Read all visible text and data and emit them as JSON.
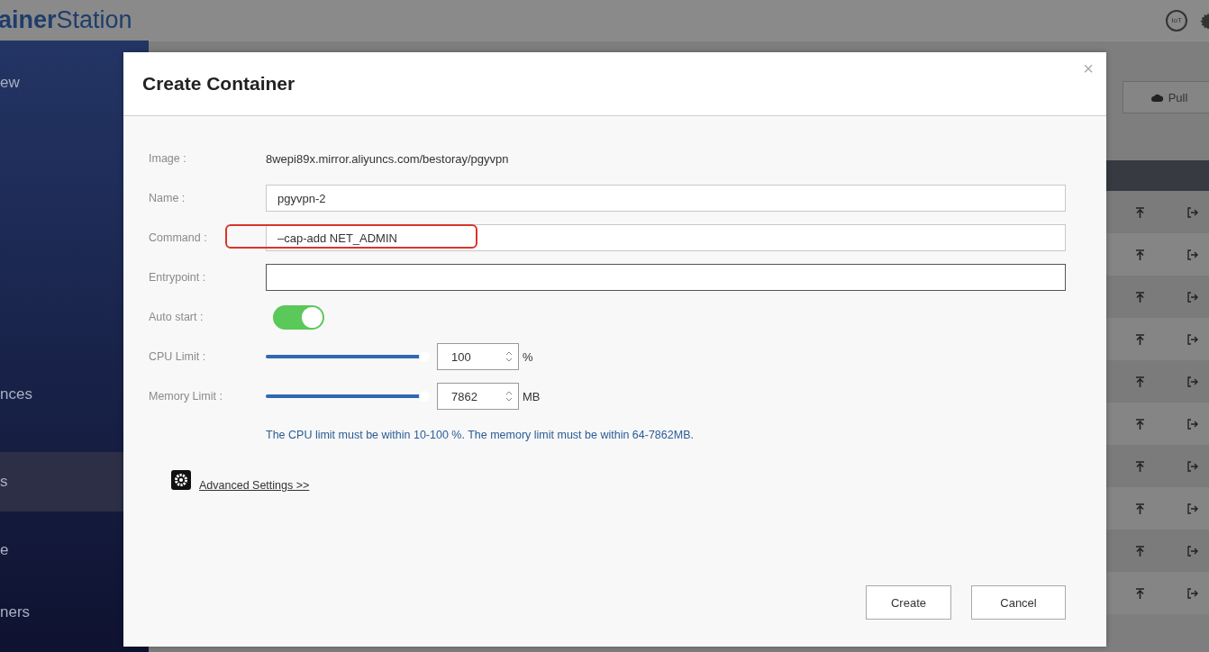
{
  "app_title": "**ainer**Station",
  "header_icons": [
    {
      "kind": "iot",
      "label": "IoT"
    },
    {
      "kind": "gear"
    }
  ],
  "sidebar": {
    "items": [
      {
        "label": "ew",
        "selected": false
      },
      {
        "label": "nces",
        "selected": false
      },
      {
        "label": "s",
        "selected": true
      },
      {
        "label": "e",
        "selected": false
      },
      {
        "label": "ners",
        "selected": false
      }
    ]
  },
  "toolbar": {
    "pull_button": "Pull"
  },
  "table": {
    "rows": [
      {
        "kind": "actions"
      },
      {
        "kind": "actions"
      },
      {
        "kind": "actions"
      },
      {
        "kind": "actions"
      },
      {
        "kind": "actions"
      },
      {
        "kind": "actions"
      },
      {
        "kind": "actions"
      },
      {
        "kind": "actions"
      },
      {
        "kind": "actions"
      },
      {
        "kind": "actions"
      }
    ]
  },
  "dialog": {
    "title": "Create Container",
    "close": "×",
    "fields": [
      {
        "kind": "text",
        "label": "Image :",
        "value": "8wepi89x.mirror.aliyuncs.com/bestoray/pgyvpn"
      },
      {
        "kind": "input",
        "label": "Name :",
        "value": "pgyvpn-2"
      },
      {
        "kind": "input",
        "label": "Command :",
        "value": "–cap-add NET_ADMIN",
        "highlighted": true
      },
      {
        "kind": "input",
        "label": "Entrypoint :",
        "focused": true
      },
      {
        "kind": "toggle",
        "label": "Auto start :",
        "on": true
      },
      {
        "kind": "slider",
        "label": "CPU Limit :",
        "level": 0.99,
        "value": "100",
        "unit": "%"
      },
      {
        "kind": "slider",
        "label": "Memory Limit :",
        "level": 0.99,
        "value": "7862",
        "unit": "MB"
      }
    ],
    "note": "The CPU limit must be within 10-100 %. The memory limit must be within 64-7862MB.",
    "advanced_link": "Advanced Settings >>",
    "buttons": [
      "Create",
      "Cancel"
    ]
  }
}
